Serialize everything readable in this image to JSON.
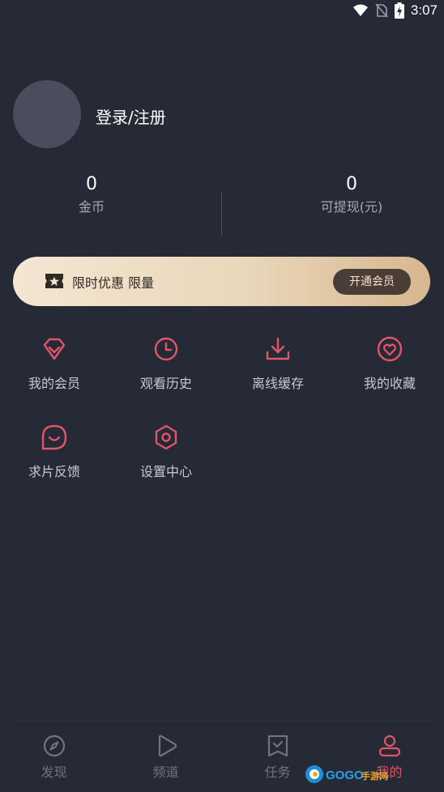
{
  "status_bar": {
    "time": "3:07"
  },
  "profile": {
    "login_label": "登录/注册"
  },
  "stats": [
    {
      "value": "0",
      "label": "金币"
    },
    {
      "value": "0",
      "label": "可提现(元)"
    }
  ],
  "vip_banner": {
    "text": "限时优惠 限量",
    "button_label": "开通会员"
  },
  "menu": [
    {
      "label": "我的会员",
      "icon": "diamond-icon"
    },
    {
      "label": "观看历史",
      "icon": "clock-icon"
    },
    {
      "label": "离线缓存",
      "icon": "download-icon"
    },
    {
      "label": "我的收藏",
      "icon": "heart-icon"
    },
    {
      "label": "求片反馈",
      "icon": "chat-bubble-icon"
    },
    {
      "label": "设置中心",
      "icon": "hexagon-gear-icon"
    }
  ],
  "nav": [
    {
      "label": "发现",
      "icon": "compass-icon"
    },
    {
      "label": "频道",
      "icon": "play-icon"
    },
    {
      "label": "任务",
      "icon": "task-icon"
    },
    {
      "label": "我的",
      "icon": "user-icon",
      "active": true
    }
  ],
  "watermark": {
    "text": "GOGO手游网"
  },
  "colors": {
    "background": "#262a36",
    "accent": "#e25566",
    "gold": "#ead7bb"
  }
}
